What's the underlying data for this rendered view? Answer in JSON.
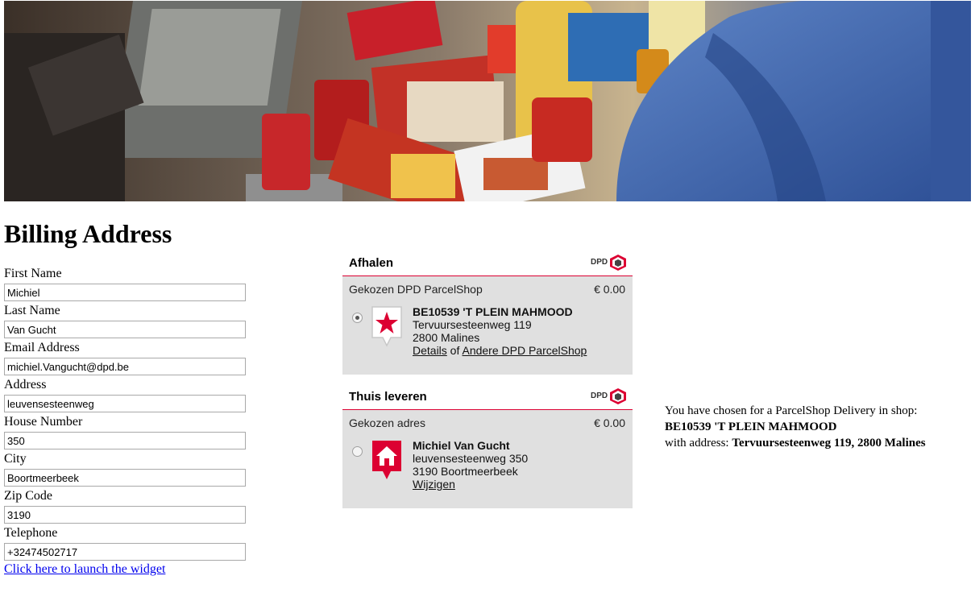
{
  "billing": {
    "heading": "Billing Address",
    "fields": [
      {
        "label": "First Name",
        "value": "Michiel"
      },
      {
        "label": "Last Name",
        "value": "Van Gucht"
      },
      {
        "label": "Email Address",
        "value": "michiel.Vangucht@dpd.be"
      },
      {
        "label": "Address",
        "value": "leuvensesteenweg"
      },
      {
        "label": "House Number",
        "value": "350"
      },
      {
        "label": "City",
        "value": "Boortmeerbeek"
      },
      {
        "label": "Zip Code",
        "value": "3190"
      },
      {
        "label": "Telephone",
        "value": "+32474502717"
      }
    ],
    "launch_link": "Click here to launch the widget"
  },
  "widget": {
    "logo_text": "DPD",
    "pickup": {
      "title": "Afhalen",
      "row_label": "Gekozen DPD ParcelShop",
      "price": "€ 0.00",
      "selected": true,
      "name": "BE10539 'T PLEIN MAHMOOD",
      "street": "Tervuursesteenweg 119",
      "city": "2800 Malines",
      "details_link": "Details",
      "or_text": " of ",
      "other_link": "Andere DPD ParcelShop",
      "icon": "star-marker-icon"
    },
    "home": {
      "title": "Thuis leveren",
      "row_label": "Gekozen adres",
      "price": "€ 0.00",
      "selected": false,
      "name": "Michiel Van Gucht",
      "street": "leuvensesteenweg 350",
      "city": "3190 Boortmeerbeek",
      "change_link": "Wijzigen",
      "icon": "house-marker-icon"
    }
  },
  "summary": {
    "line1": "You have chosen for a ParcelShop Delivery in shop:",
    "shop": "BE10539 'T PLEIN MAHMOOD",
    "line3_prefix": "with address: ",
    "address": "Tervuursesteenweg 119, 2800 Malines"
  },
  "colors": {
    "dpd_red": "#dc0032",
    "panel_bg": "#e0e0e0",
    "link_blue": "#0000ee"
  }
}
